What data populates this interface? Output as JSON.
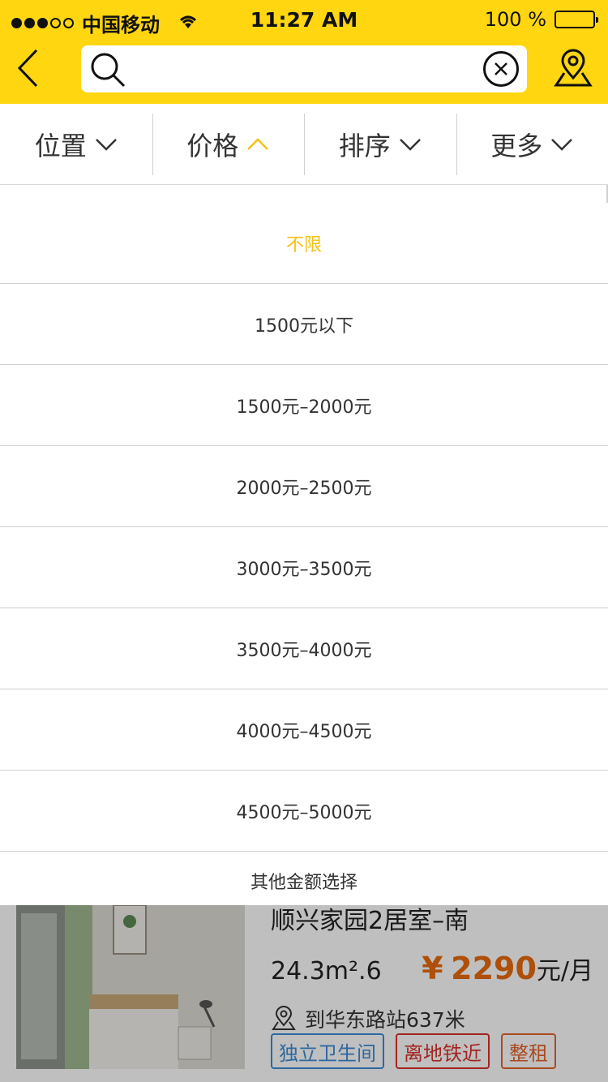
{
  "status_bar": {
    "carrier": "中国移动",
    "time": "11:27 AM",
    "battery_text": "100 %"
  },
  "search": {
    "value": "",
    "placeholder": ""
  },
  "tabs": [
    {
      "label": "位置",
      "state": "collapsed"
    },
    {
      "label": "价格",
      "state": "expanded"
    },
    {
      "label": "排序",
      "state": "collapsed"
    },
    {
      "label": "更多",
      "state": "collapsed"
    }
  ],
  "price_options": [
    "不限",
    "1500元以下",
    "1500元–2000元",
    "2000元–2500元",
    "3000元–3500元",
    "3500元–4000元",
    "4000元–4500元",
    "4500元–5000元"
  ],
  "other_amount": "其他金额选择",
  "listing": {
    "title": "顺兴家园2居室–南",
    "area": "24.3m²",
    "area_suffix": ".6",
    "price_symbol": "¥",
    "price": "2290",
    "price_unit": "元/月",
    "distance": "到华东路站637米",
    "tags": [
      "独立卫生间",
      "离地铁近",
      "整租"
    ]
  },
  "colors": {
    "accent": "#FFD60F",
    "active_option": "#F5C214",
    "price": "#E96A0E"
  }
}
